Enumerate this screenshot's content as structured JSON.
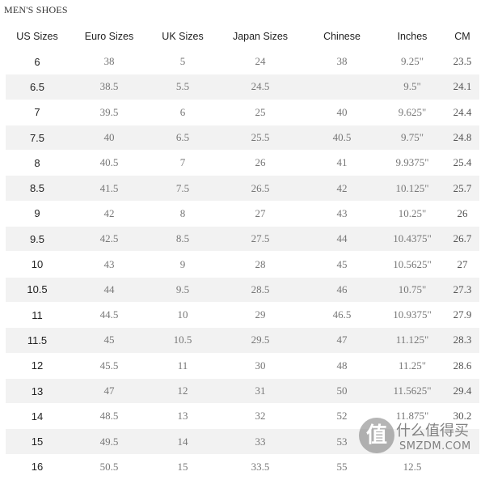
{
  "title": "MEN'S SHOES",
  "columns": [
    "US Sizes",
    "Euro Sizes",
    "UK Sizes",
    "Japan Sizes",
    "Chinese",
    "Inches",
    "CM"
  ],
  "rows": [
    [
      "6",
      "38",
      "5",
      "24",
      "38",
      "9.25\"",
      "23.5"
    ],
    [
      "6.5",
      "38.5",
      "5.5",
      "24.5",
      "",
      "9.5\"",
      "24.1"
    ],
    [
      "7",
      "39.5",
      "6",
      "25",
      "40",
      "9.625\"",
      "24.4"
    ],
    [
      "7.5",
      "40",
      "6.5",
      "25.5",
      "40.5",
      "9.75\"",
      "24.8"
    ],
    [
      "8",
      "40.5",
      "7",
      "26",
      "41",
      "9.9375\"",
      "25.4"
    ],
    [
      "8.5",
      "41.5",
      "7.5",
      "26.5",
      "42",
      "10.125\"",
      "25.7"
    ],
    [
      "9",
      "42",
      "8",
      "27",
      "43",
      "10.25\"",
      "26"
    ],
    [
      "9.5",
      "42.5",
      "8.5",
      "27.5",
      "44",
      "10.4375\"",
      "26.7"
    ],
    [
      "10",
      "43",
      "9",
      "28",
      "45",
      "10.5625\"",
      "27"
    ],
    [
      "10.5",
      "44",
      "9.5",
      "28.5",
      "46",
      "10.75\"",
      "27.3"
    ],
    [
      "11",
      "44.5",
      "10",
      "29",
      "46.5",
      "10.9375\"",
      "27.9"
    ],
    [
      "11.5",
      "45",
      "10.5",
      "29.5",
      "47",
      "11.125\"",
      "28.3"
    ],
    [
      "12",
      "45.5",
      "11",
      "30",
      "48",
      "11.25\"",
      "28.6"
    ],
    [
      "13",
      "47",
      "12",
      "31",
      "50",
      "11.5625\"",
      "29.4"
    ],
    [
      "14",
      "48.5",
      "13",
      "32",
      "52",
      "11.875\"",
      "30.2"
    ],
    [
      "15",
      "49.5",
      "14",
      "33",
      "53",
      "",
      ""
    ],
    [
      "16",
      "50.5",
      "15",
      "33.5",
      "55",
      "12.5",
      ""
    ]
  ],
  "watermark": {
    "badge": "值",
    "text": "什么值得买",
    "site": "SMZDM.COM"
  }
}
